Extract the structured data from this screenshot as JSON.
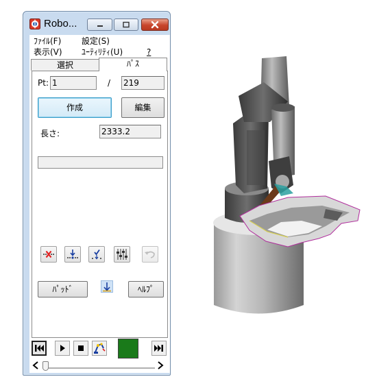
{
  "window": {
    "title": "Robo...",
    "minimize_glyph": "▁",
    "maximize_glyph": "□",
    "close_glyph": "✕"
  },
  "menu": {
    "file": "ﾌｧｲﾙ(F)",
    "settings": "設定(S)",
    "view": "表示(V)",
    "utility": "ﾕｰﾃｨﾘﾃｨ(U)",
    "help": "?"
  },
  "tabs": {
    "select": "選択",
    "path": "ﾊﾟｽ"
  },
  "path": {
    "pt_label": "Pt:",
    "pt_value": "1",
    "separator": "/",
    "pt_total": "219",
    "create_button": "作成",
    "edit_button": "編集",
    "length_label": "長さ:",
    "length_value": "2333.2",
    "progress": 0
  },
  "tools": {
    "delete_point": "delete-point-icon",
    "insert_point": "insert-point-icon",
    "check_point": "check-point-icon",
    "adjust": "adjust-sliders-icon",
    "undo": "undo-icon"
  },
  "buttons": {
    "pad": "ﾊﾟｯﾄﾞ",
    "help": "ﾍﾙﾌﾟ",
    "direction_icon": "down-arrow-icon"
  },
  "playback": {
    "status_color": "#1a7a1a"
  },
  "colors": {
    "accent": "#3c9dc9",
    "window_frame": "#c9dbef",
    "close": "#c8452c",
    "delete_x": "#e02020"
  }
}
